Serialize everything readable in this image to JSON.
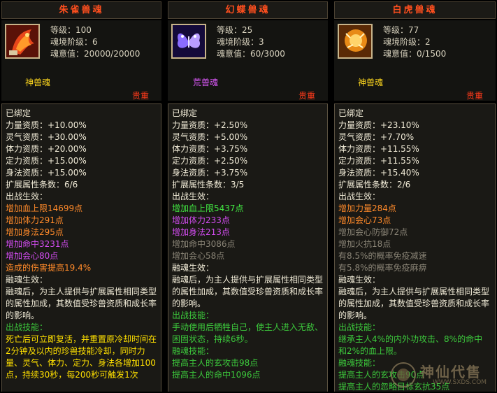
{
  "panels": [
    {
      "title": "朱雀兽魂",
      "stats": [
        "等级：100",
        "魂境阶级：6",
        "魂意值：20000/20000"
      ],
      "kind": "神兽魂",
      "precious": "贵重",
      "lines": [
        {
          "t": "已绑定",
          "c": "w"
        },
        {
          "t": "力量资质：+10.00%",
          "c": "w"
        },
        {
          "t": "灵气资质：+30.00%",
          "c": "w"
        },
        {
          "t": "体力资质：+20.00%",
          "c": "w"
        },
        {
          "t": "定力资质：+15.00%",
          "c": "w"
        },
        {
          "t": "身法资质：+15.00%",
          "c": "w"
        },
        {
          "t": "扩展属性条数：6/6",
          "c": "w"
        },
        {
          "t": "出战生效：",
          "c": "w"
        },
        {
          "t": "增加血上限14699点",
          "c": "o"
        },
        {
          "t": "增加体力291点",
          "c": "o"
        },
        {
          "t": "增加身法295点",
          "c": "o"
        },
        {
          "t": "增加命中3231点",
          "c": "p"
        },
        {
          "t": "增加会心80点",
          "c": "p"
        },
        {
          "t": "造成的伤害提高19.4%",
          "c": "o"
        },
        {
          "t": "融魂生效：",
          "c": "w"
        },
        {
          "t": "融魂后，为主人提供与扩展属性相同类型的属性加成，其数值受珍兽资质和成长率的影响。",
          "c": "w",
          "wrap": true
        },
        {
          "t": "出战技能：",
          "c": "dg"
        },
        {
          "t": "死亡后可立即复活，并重置原冷却时间在2分钟及以内的珍兽技能冷却，同时力量、灵气、体力、定力、身法各增加100点，持续30秒，每200秒可触发1次",
          "c": "y",
          "wrap": true
        }
      ]
    },
    {
      "title": "幻蝶兽魂",
      "stats": [
        "等级：25",
        "魂境阶级：3",
        "魂意值：60/3000"
      ],
      "kind": "荒兽魂",
      "precious": "贵重",
      "lines": [
        {
          "t": "已绑定",
          "c": "w"
        },
        {
          "t": "力量资质：+2.50%",
          "c": "w"
        },
        {
          "t": "灵气资质：+5.00%",
          "c": "w"
        },
        {
          "t": "体力资质：+3.75%",
          "c": "w"
        },
        {
          "t": "定力资质：+2.50%",
          "c": "w"
        },
        {
          "t": "身法资质：+3.75%",
          "c": "w"
        },
        {
          "t": "扩展属性条数：3/5",
          "c": "w"
        },
        {
          "t": "出战生效：",
          "c": "w"
        },
        {
          "t": "增加血上限5437点",
          "c": "g"
        },
        {
          "t": "增加体力233点",
          "c": "p"
        },
        {
          "t": "增加身法213点",
          "c": "p"
        },
        {
          "t": "增加命中3086点",
          "c": "gr"
        },
        {
          "t": "增加会心58点",
          "c": "gr"
        },
        {
          "t": "融魂生效：",
          "c": "w"
        },
        {
          "t": "融魂后，为主人提供与扩展属性相同类型的属性加成，其数值受珍兽资质和成长率的影响。",
          "c": "w",
          "wrap": true
        },
        {
          "t": "出战技能：",
          "c": "dg"
        },
        {
          "t": "手动使用后牺牲自己，使主人进入无敌、困固状态，持续6秒。",
          "c": "dg",
          "wrap": true
        },
        {
          "t": "融魂技能：",
          "c": "dg"
        },
        {
          "t": "提高主人的玄攻击98点",
          "c": "dg"
        },
        {
          "t": "提高主人的命中1096点",
          "c": "dg"
        }
      ]
    },
    {
      "title": "白虎兽魂",
      "stats": [
        "等级：77",
        "魂境阶级：2",
        "魂意值：0/1500"
      ],
      "kind": "神兽魂",
      "precious": "贵重",
      "lines": [
        {
          "t": "已绑定",
          "c": "w"
        },
        {
          "t": "力量资质：+23.10%",
          "c": "w"
        },
        {
          "t": "灵气资质：+7.70%",
          "c": "w"
        },
        {
          "t": "体力资质：+11.55%",
          "c": "w"
        },
        {
          "t": "定力资质：+11.55%",
          "c": "w"
        },
        {
          "t": "身法资质：+15.40%",
          "c": "w"
        },
        {
          "t": "扩展属性条数：2/6",
          "c": "w"
        },
        {
          "t": "出战生效：",
          "c": "w"
        },
        {
          "t": "增加力量284点",
          "c": "o"
        },
        {
          "t": "增加会心73点",
          "c": "o"
        },
        {
          "t": "增加会心防御72点",
          "c": "gr"
        },
        {
          "t": "增加火抗18点",
          "c": "gr"
        },
        {
          "t": "有8.5%的概率免疫减速",
          "c": "gr"
        },
        {
          "t": "有5.8%的概率免疫麻痹",
          "c": "gr"
        },
        {
          "t": "融魂生效：",
          "c": "w"
        },
        {
          "t": "融魂后，为主人提供与扩展属性相同类型的属性加成，其数值受珍兽资质和成长率的影响。",
          "c": "w",
          "wrap": true
        },
        {
          "t": "出战技能：",
          "c": "dg"
        },
        {
          "t": "继承主人4%的内外功攻击、8%的命中和2%的血上限。",
          "c": "dg",
          "wrap": true
        },
        {
          "t": "融魂技能：",
          "c": "dg"
        },
        {
          "t": "提高主人的玄攻击90点",
          "c": "dg"
        },
        {
          "t": "提高主人的忽略目标玄抗35点",
          "c": "dg"
        }
      ]
    }
  ],
  "watermark": {
    "brand": "神仙代售",
    "url": "WWW.SXDS.COM"
  }
}
